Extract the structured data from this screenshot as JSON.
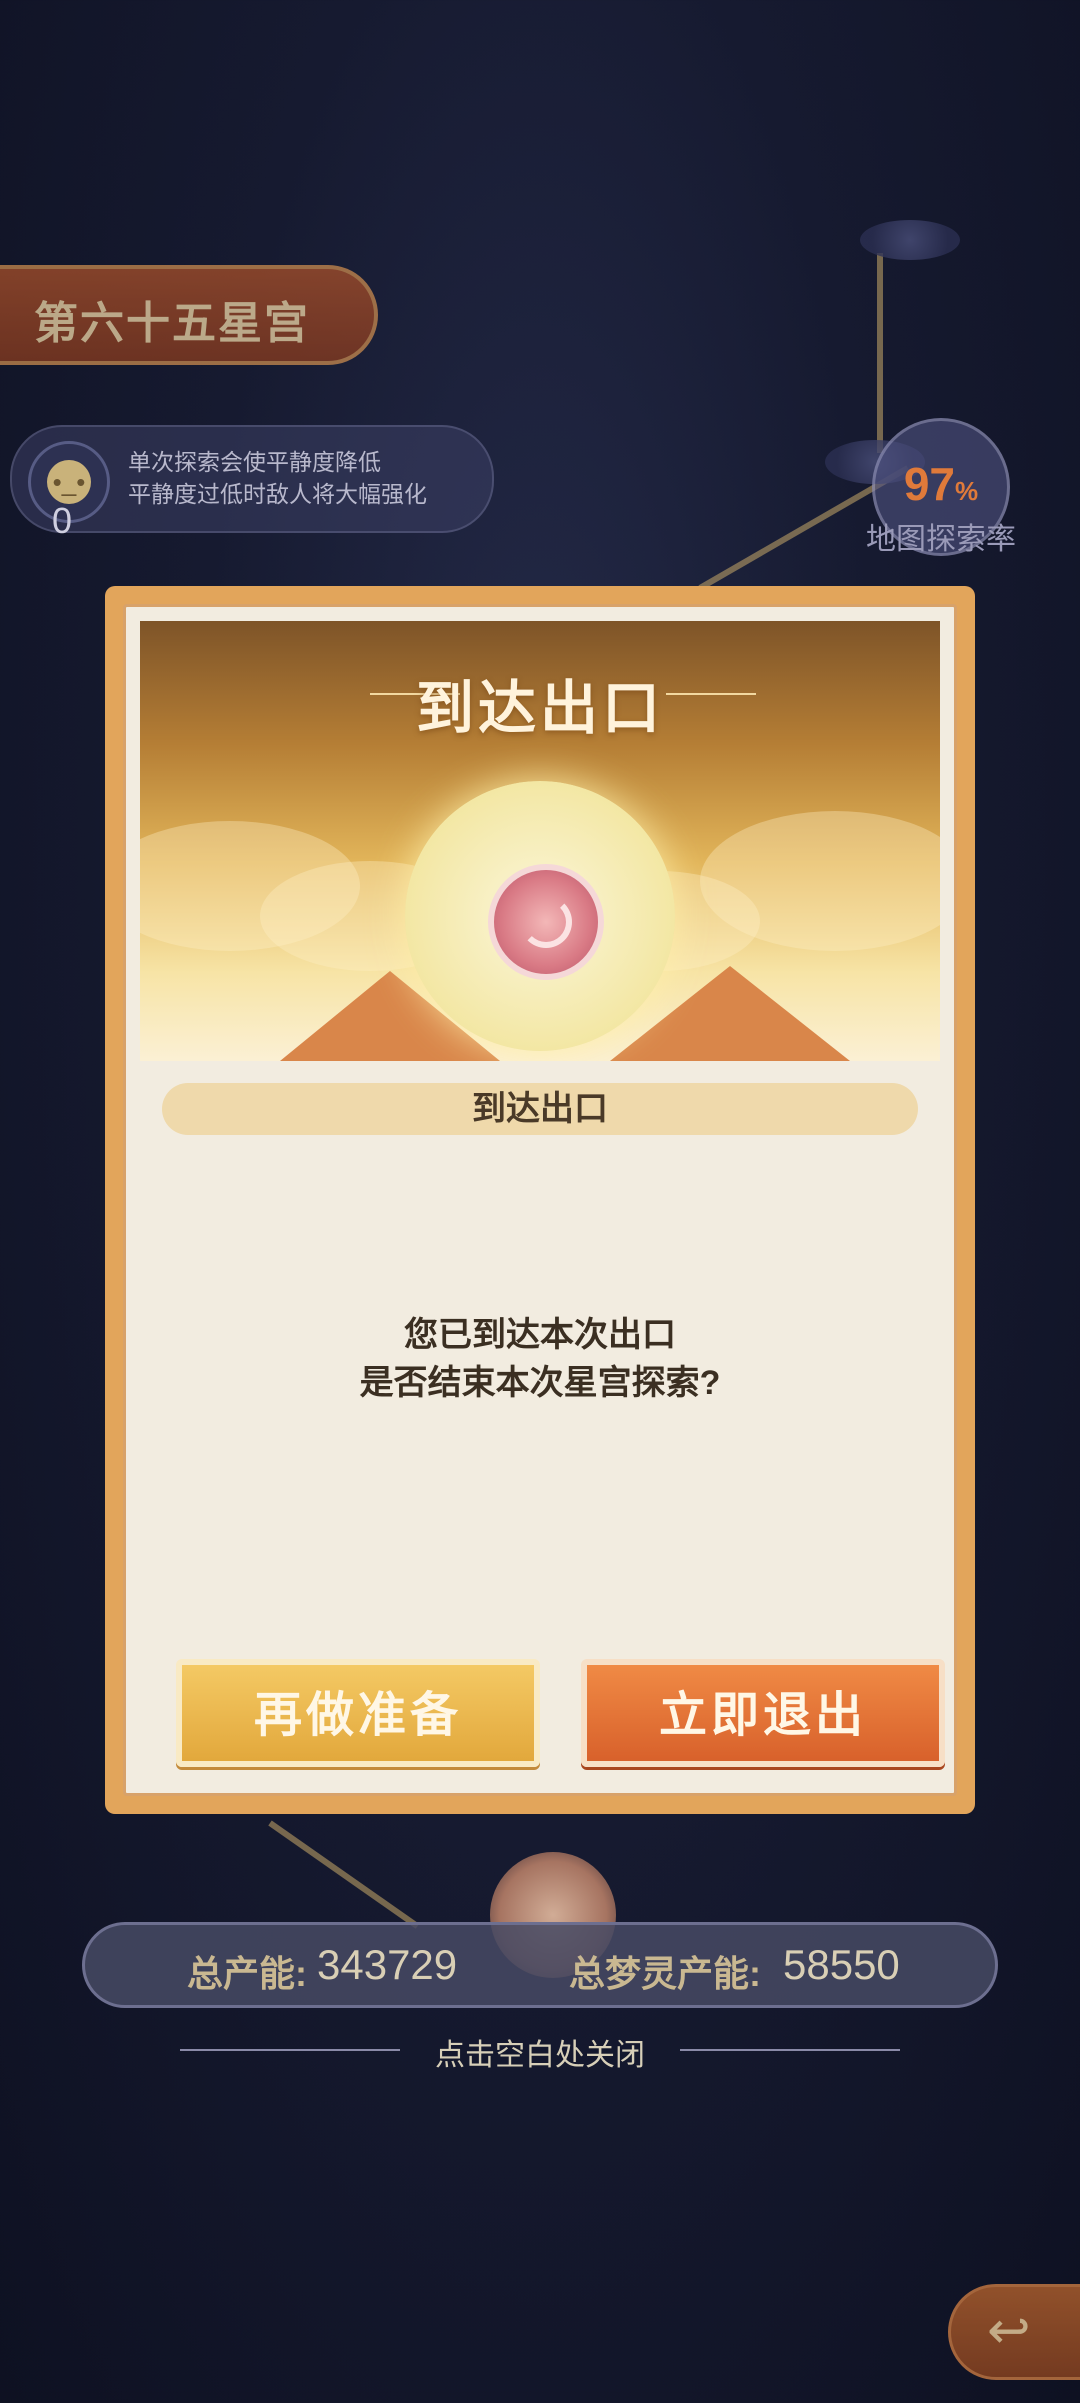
{
  "stage": {
    "name": "第六十五星宫"
  },
  "calm": {
    "count": "0",
    "line1": "单次探索会使平静度降低",
    "line2": "平静度过低时敌人将大幅强化"
  },
  "exploration": {
    "rate_value": "97",
    "rate_unit": "%",
    "label": "地图探索率"
  },
  "modal": {
    "header_title": "到达出口",
    "subtitle": "到达出口",
    "message_line1": "您已到达本次出口",
    "message_line2": "是否结束本次星宫探索?",
    "btn_prepare": "再做准备",
    "btn_exit": "立即退出"
  },
  "totals": {
    "total_label": "总产能:",
    "total_value": "343729",
    "spirit_label": "总梦灵产能:",
    "spirit_value": "58550"
  },
  "close_hint": "点击空白处关闭",
  "colors": {
    "modal_frame": "#e2a55b",
    "prepare_button": "#e2a83c",
    "exit_button": "#d8612b",
    "rate_text": "#e07a3a"
  }
}
